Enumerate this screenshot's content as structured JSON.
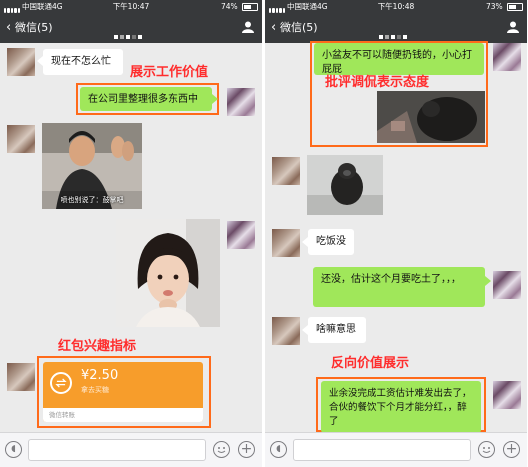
{
  "left": {
    "status": {
      "carrier": "中国联通",
      "network": "4G",
      "time": "下午10:47",
      "battery": "74%",
      "battery_level": 0.74
    },
    "nav": {
      "back_label": "微信(5)"
    },
    "messages": [
      {
        "text": "现在不怎么忙"
      },
      {
        "text": "在公司里整理很多东西中"
      },
      {
        "sticker_caption": "喷也别说了：鼓掌吧"
      }
    ],
    "annotations": {
      "work_value": "展示工作价值",
      "red_packet": "红包兴趣指标"
    },
    "red_packet": {
      "amount": "¥2.50",
      "note": "拿去买糖",
      "footer": "微信转账"
    }
  },
  "right": {
    "status": {
      "carrier": "中国联通",
      "network": "4G",
      "time": "下午10:48",
      "battery": "73%",
      "battery_level": 0.73
    },
    "nav": {
      "back_label": "微信(5)"
    },
    "messages": [
      {
        "text": "小盆友不可以随便扔钱的，小心打屁屁"
      },
      {
        "text": "吃饭没"
      },
      {
        "text": "还没，估计这个月要吃土了，，，"
      },
      {
        "text": "啥嘛意思"
      },
      {
        "text": "业余没完成工资估计难发出去了，合伙的餐饮下个月才能分红，，醉了"
      }
    ],
    "annotations": {
      "criticize": "批评调侃表示态度",
      "reverse_value": "反向价值展示"
    }
  }
}
